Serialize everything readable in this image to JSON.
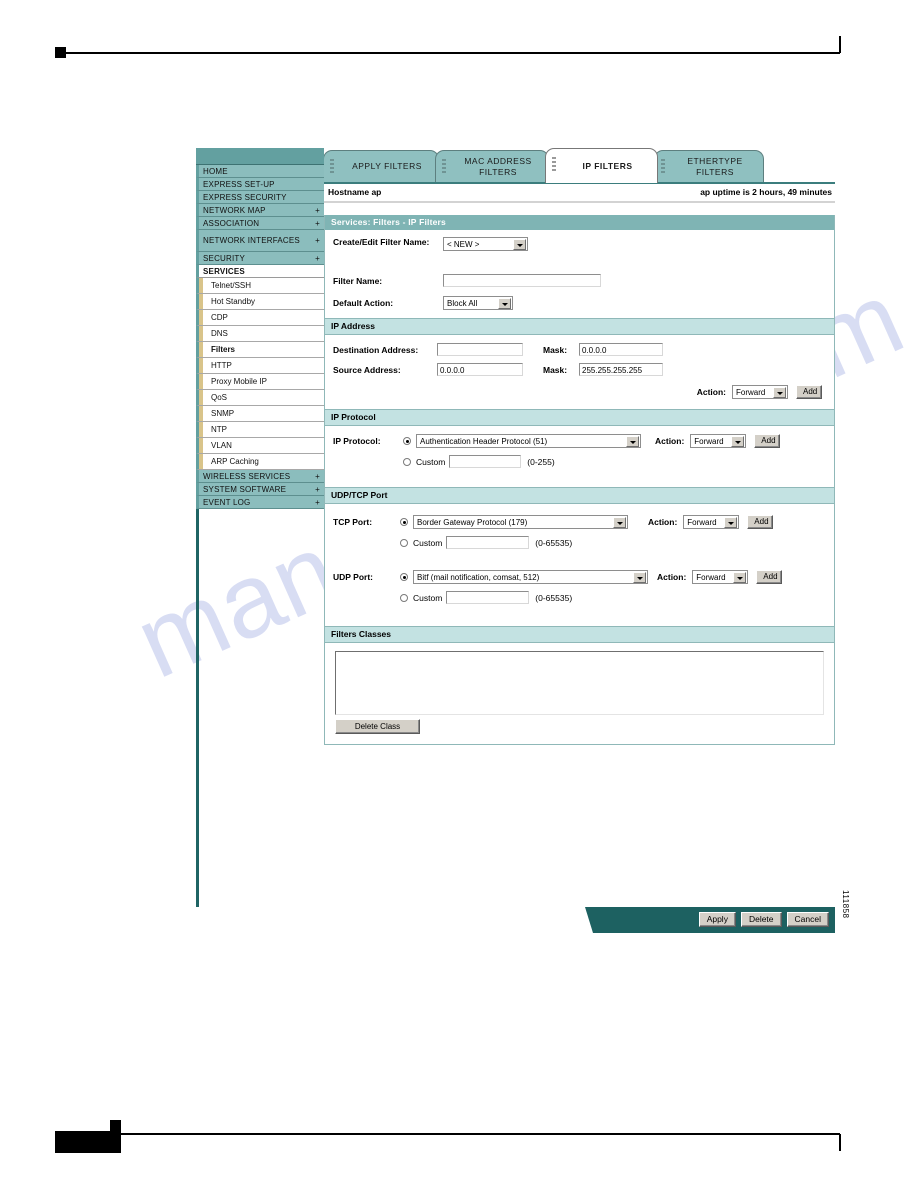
{
  "page": {
    "figure_id": "111858",
    "watermark": "manualshive.com"
  },
  "tabs": [
    {
      "label": "APPLY FILTERS",
      "active": false
    },
    {
      "label": "MAC ADDRESS FILTERS",
      "active": false
    },
    {
      "label": "IP FILTERS",
      "active": true
    },
    {
      "label": "ETHERTYPE FILTERS",
      "active": false
    }
  ],
  "statusbar": {
    "hostname": "Hostname  ap",
    "uptime": "ap uptime is 2 hours, 49 minutes"
  },
  "sidebar": {
    "items": [
      {
        "label": "HOME",
        "plus": "",
        "type": "top"
      },
      {
        "label": "EXPRESS SET-UP",
        "plus": "",
        "type": "top"
      },
      {
        "label": "EXPRESS SECURITY",
        "plus": "",
        "type": "top"
      },
      {
        "label": "NETWORK MAP",
        "plus": "+",
        "type": "top"
      },
      {
        "label": "ASSOCIATION",
        "plus": "+",
        "type": "top"
      },
      {
        "label": "NETWORK INTERFACES",
        "plus": "+",
        "type": "top-tall"
      },
      {
        "label": "SECURITY",
        "plus": "+",
        "type": "top"
      },
      {
        "label": "SERVICES",
        "plus": "",
        "type": "section-open"
      },
      {
        "label": "Telnet/SSH",
        "plus": "",
        "type": "sub"
      },
      {
        "label": "Hot Standby",
        "plus": "",
        "type": "sub"
      },
      {
        "label": "CDP",
        "plus": "",
        "type": "sub"
      },
      {
        "label": "DNS",
        "plus": "",
        "type": "sub"
      },
      {
        "label": "Filters",
        "plus": "",
        "type": "sub-current"
      },
      {
        "label": "HTTP",
        "plus": "",
        "type": "sub"
      },
      {
        "label": "Proxy Mobile IP",
        "plus": "",
        "type": "sub"
      },
      {
        "label": "QoS",
        "plus": "",
        "type": "sub"
      },
      {
        "label": "SNMP",
        "plus": "",
        "type": "sub"
      },
      {
        "label": "NTP",
        "plus": "",
        "type": "sub"
      },
      {
        "label": "VLAN",
        "plus": "",
        "type": "sub"
      },
      {
        "label": "ARP Caching",
        "plus": "",
        "type": "sub"
      },
      {
        "label": "WIRELESS SERVICES",
        "plus": "+",
        "type": "top"
      },
      {
        "label": "SYSTEM SOFTWARE",
        "plus": "+",
        "type": "top"
      },
      {
        "label": "EVENT LOG",
        "plus": "+",
        "type": "top"
      }
    ]
  },
  "main": {
    "panel_title": "Services: Filters - IP Filters",
    "filter": {
      "create_edit_label": "Create/Edit Filter Name:",
      "create_edit_value": "< NEW >",
      "filter_name_label": "Filter Name:",
      "filter_name_value": "",
      "default_action_label": "Default Action:",
      "default_action_value": "Block All"
    },
    "ip_address": {
      "section": "IP Address",
      "dest_label": "Destination Address:",
      "dest_value": "",
      "dest_mask_label": "Mask:",
      "dest_mask_value": "0.0.0.0",
      "src_label": "Source Address:",
      "src_value": "0.0.0.0",
      "src_mask_label": "Mask:",
      "src_mask_value": "255.255.255.255",
      "action_label": "Action:",
      "action_value": "Forward",
      "add_label": "Add"
    },
    "ip_protocol": {
      "section": "IP Protocol",
      "label": "IP Protocol:",
      "select_value": "Authentication Header Protocol (51)",
      "custom_label": "Custom",
      "custom_value": "",
      "range_hint": "(0-255)",
      "action_label": "Action:",
      "action_value": "Forward",
      "add_label": "Add"
    },
    "udp_tcp": {
      "section": "UDP/TCP Port",
      "tcp_label": "TCP Port:",
      "tcp_select_value": "Border Gateway Protocol (179)",
      "tcp_custom_label": "Custom",
      "tcp_custom_value": "",
      "tcp_range_hint": "(0-65535)",
      "tcp_action_label": "Action:",
      "tcp_action_value": "Forward",
      "tcp_add_label": "Add",
      "udp_label": "UDP Port:",
      "udp_select_value": "Bitf (mail notification, comsat, 512)",
      "udp_custom_label": "Custom",
      "udp_custom_value": "",
      "udp_range_hint": "(0-65535)",
      "udp_action_label": "Action:",
      "udp_action_value": "Forward",
      "udp_add_label": "Add"
    },
    "filter_classes": {
      "section": "Filters Classes",
      "list_value": "",
      "delete_class_label": "Delete Class"
    }
  },
  "footer": {
    "apply_label": "Apply",
    "delete_label": "Delete",
    "cancel_label": "Cancel"
  }
}
